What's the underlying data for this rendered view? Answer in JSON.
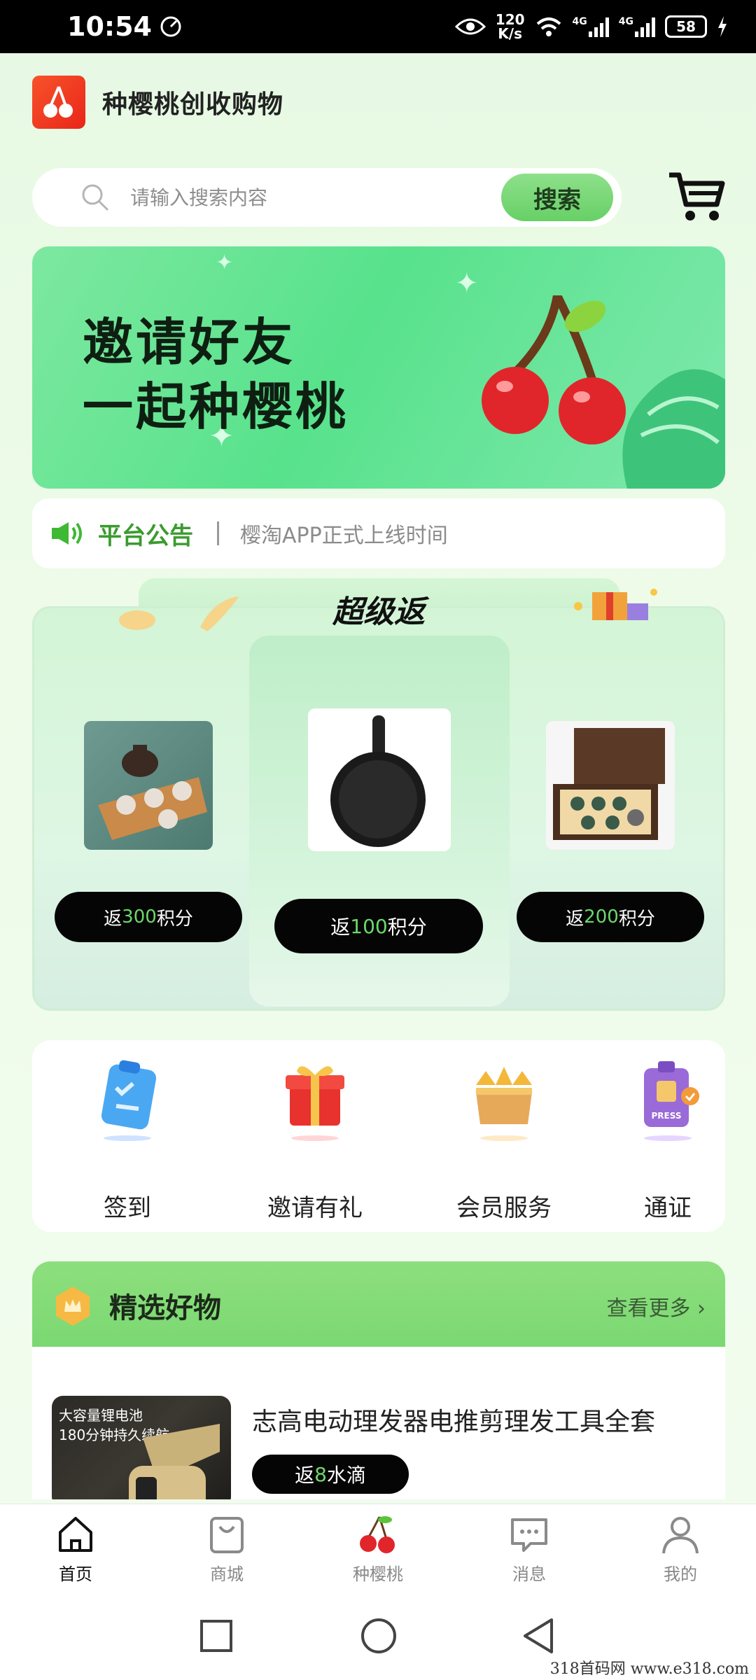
{
  "status_bar": {
    "time": "10:54",
    "net_speed_value": "120",
    "net_speed_unit": "K/s",
    "sim1": "4G",
    "sim2": "4G",
    "battery": "58"
  },
  "header": {
    "app_title": "种樱桃创收购物"
  },
  "search": {
    "placeholder": "请输入搜索内容",
    "button_label": "搜索"
  },
  "banner": {
    "line1": "邀请好友",
    "line2": "一起种樱桃"
  },
  "notice": {
    "title": "平台公告",
    "text": "樱淘APP正式上线时间"
  },
  "super_return": {
    "title": "超级返",
    "products": [
      {
        "prefix": "返",
        "points": "300",
        "suffix": "积分",
        "image": "tea-set"
      },
      {
        "prefix": "返",
        "points": "100",
        "suffix": "积分",
        "image": "frying-pan"
      },
      {
        "prefix": "返",
        "points": "200",
        "suffix": "积分",
        "image": "tea-gift-box"
      }
    ]
  },
  "quick_actions": [
    {
      "label": "签到",
      "icon": "checkin-clipboard-icon"
    },
    {
      "label": "邀请有礼",
      "icon": "gift-box-icon"
    },
    {
      "label": "会员服务",
      "icon": "crown-box-icon"
    },
    {
      "label": "通证",
      "icon": "press-badge-icon"
    }
  ],
  "selected_goods": {
    "title": "精选好物",
    "more_label": "查看更多",
    "item": {
      "title": "志高电动理发器电推剪理发工具全套",
      "image_caption_line1": "大容量锂电池",
      "image_caption_line2": "180分钟持久续航",
      "return_prefix": "返",
      "return_amount": "8",
      "return_suffix": "水滴"
    }
  },
  "bottom_nav": [
    {
      "label": "首页",
      "icon": "home-icon",
      "active": true
    },
    {
      "label": "商城",
      "icon": "shopping-bag-icon",
      "active": false
    },
    {
      "label": "种樱桃",
      "icon": "cherry-icon",
      "active": false
    },
    {
      "label": "消息",
      "icon": "message-icon",
      "active": false
    },
    {
      "label": "我的",
      "icon": "profile-icon",
      "active": false
    }
  ],
  "watermark": "318首码网  www.e318.com",
  "colors": {
    "accent_green": "#67d066",
    "points_green": "#6bd86a",
    "notice_green": "#3b9b2f",
    "logo_red": "#e9261a"
  }
}
